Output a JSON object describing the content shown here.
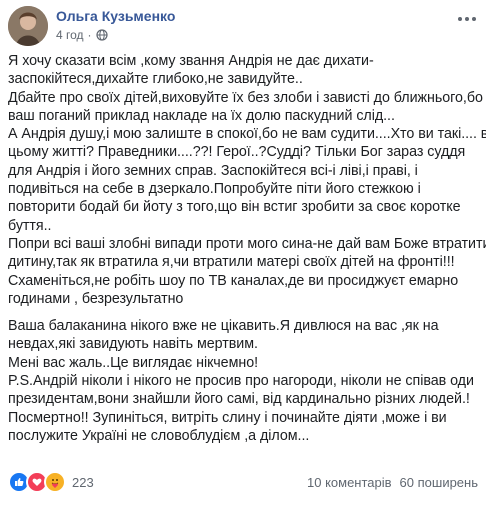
{
  "post": {
    "author": "Ольга Кузьменко",
    "timestamp": "4 год",
    "privacy_icon": "globe-icon",
    "lines": [
      "Я хочу сказати всім ,кому звання Андрія не дає дихати-",
      "заспокійтеся,дихайте глибоко,не завидуйте..",
      "Дбайте про своїх дітей,виховуйте їх без злоби і зависті до ближнього,бо",
      "ваш поганий приклад накладе на їх долю паскудний слід...",
      "А Андрія душу,і мою залиште в спокої,бо не вам судити....Хто ви такі.... в",
      "цьому житті? Праведники....??! Герої..?Судді? Тільки Бог зараз суддя",
      "для Андрія і його земних справ. Заспокійтеся всі-і ліві,і праві, і",
      "подивіться на себе в дзеркало.Попробуйте піти його стежкою і",
      "повторити бодай би йоту з того,що він встиг зробити за своє коротке",
      "буття..",
      "Попри всі ваші злобні випади проти мого сина-не дай вам Боже втратити",
      "дитину,так як втратила я,чи втратили матері своїх дітей на фронті!!!",
      "Схаменіться,не робіть шоу по ТВ каналах,де ви просиджуєт емарно",
      "годинами , безрезультатно"
    ],
    "lines2": [
      "Ваша балаканина нікого вже не цікавить.Я дивлюся на вас ,як на",
      "невдах,які завидують навіть мертвим.",
      "Мені вас жаль..Це виглядає нікчемно!",
      "P.S.Андрій ніколи і нікого не просив про нагороди, ніколи не співав оди",
      "президентам,вони знайшли його самі, від кардинально різних людей.!",
      "Посмертно!! Зупиніться, витріть слину і починайте діяти ,може і ви",
      "послужите Україні не словоблудієм ,а ділом..."
    ]
  },
  "footer": {
    "reaction_icons": [
      "like-icon",
      "love-icon",
      "care-icon"
    ],
    "reaction_count": "223",
    "comments": "10 коментарів",
    "shares": "60 поширень"
  },
  "colors": {
    "author": "#385898",
    "meta": "#606770",
    "text": "#1c1e21",
    "like": "#1877f2",
    "love": "#f33e58",
    "care": "#f7b125"
  }
}
